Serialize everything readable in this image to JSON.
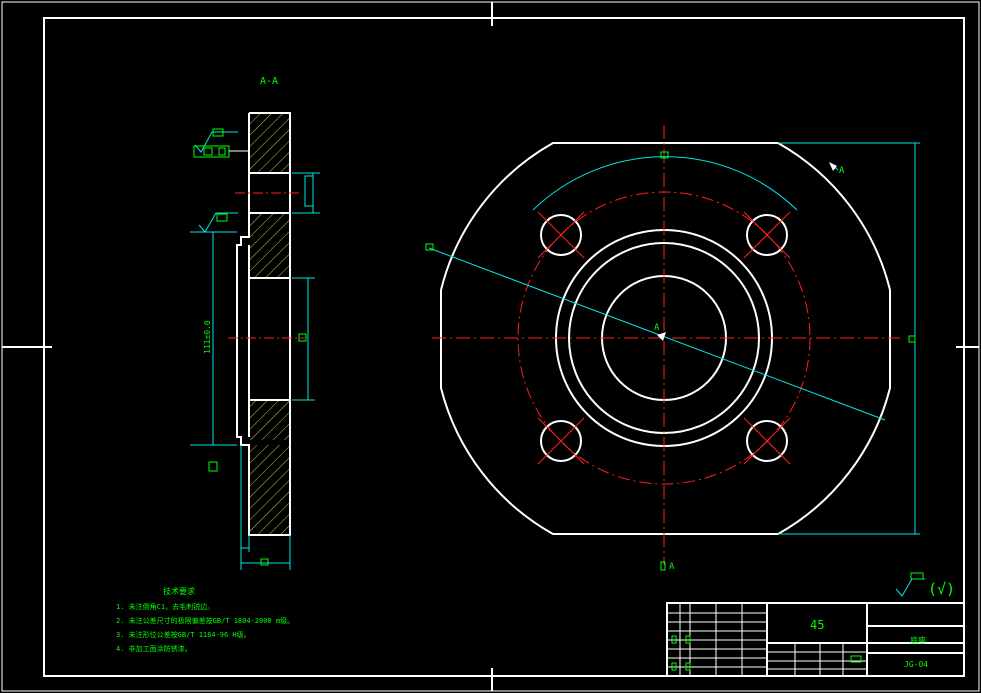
{
  "section_label": "A-A",
  "view_marker_label": "A",
  "center_label": "A",
  "cut_label_bottom": "A",
  "vertical_dim_text": "111±0.0",
  "bottom_dim_box": "",
  "tech_requirements": {
    "title": "技术要求",
    "items": [
      "1. 未注倒角C1，去毛刺锐边。",
      "2. 未注公差尺寸的极限偏差按GB/T 1804-2000 m级。",
      "3. 未注形位公差按GB/T 1184-96 H级。",
      "4. 非加工面涂防锈漆。"
    ]
  },
  "roughness_note": "(√)",
  "title_block": {
    "material": "45",
    "part_name": "底座",
    "drawing_no": "JG-04"
  },
  "colors": {
    "background": "#000000",
    "outline": "#ffffff",
    "center_line": "#ff2020",
    "dimension": "#00e5e5",
    "text": "#00ff00",
    "hatch": "#c8c840"
  }
}
